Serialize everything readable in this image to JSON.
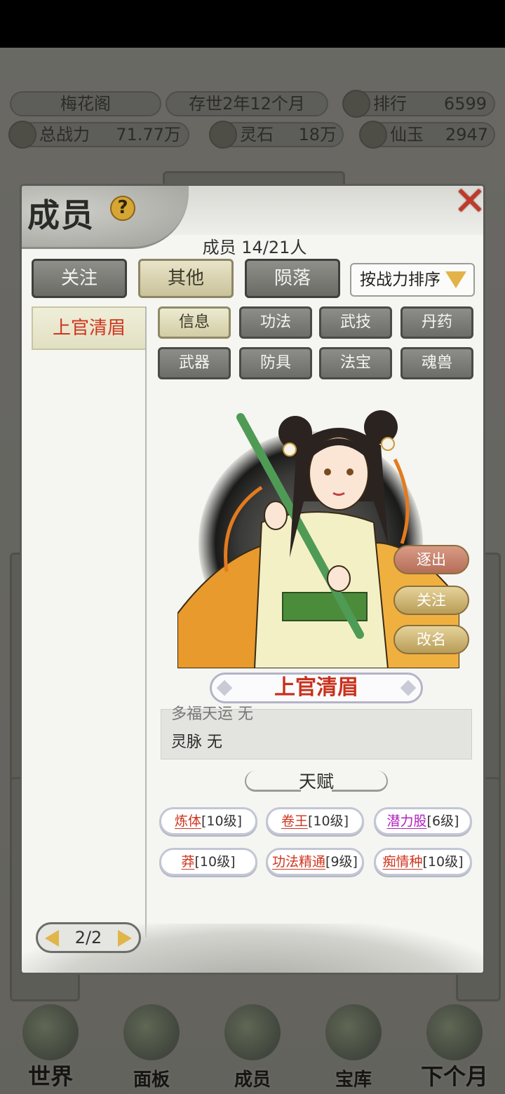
{
  "top_stats": {
    "sect_name": "梅花阁",
    "existence": "存世2年12个月",
    "rank_label": "排行",
    "rank_value": "6599",
    "power_label": "总战力",
    "power_value": "71.77万",
    "spirit_stone_label": "灵石",
    "spirit_stone_value": "18万",
    "immortal_jade_label": "仙玉",
    "immortal_jade_value": "2947"
  },
  "modal": {
    "title": "成员",
    "help_symbol": "?",
    "close_symbol": "✕",
    "member_count": "成员  14/21人",
    "filter_tabs": [
      {
        "label": "关注",
        "active": false
      },
      {
        "label": "其他",
        "active": true
      },
      {
        "label": "陨落",
        "active": false
      }
    ],
    "sort_label": "按战力排序",
    "members": [
      "上官清眉"
    ],
    "info_tabs": [
      {
        "label": "信息",
        "active": true
      },
      {
        "label": "功法",
        "active": false
      },
      {
        "label": "武技",
        "active": false
      },
      {
        "label": "丹药",
        "active": false
      },
      {
        "label": "武器",
        "active": false
      },
      {
        "label": "防具",
        "active": false
      },
      {
        "label": "法宝",
        "active": false
      },
      {
        "label": "魂兽",
        "active": false
      }
    ],
    "actions": {
      "expel": "逐出",
      "follow": "关注",
      "rename": "改名"
    },
    "character_name": "上官清眉",
    "attributes": {
      "partial_line": "多福天运 无",
      "spirit_vein": "灵脉 无"
    },
    "talent_title": "天赋",
    "talents": [
      {
        "name": "炼体",
        "level": "[10级]",
        "color": "red"
      },
      {
        "name": "卷王",
        "level": "[10级]",
        "color": "red"
      },
      {
        "name": "潜力股",
        "level": "[6级]",
        "color": "purple"
      },
      {
        "name": "莽",
        "level": "[10级]",
        "color": "red"
      },
      {
        "name": "功法精通",
        "level": "[9级]",
        "color": "red"
      },
      {
        "name": "痴情种",
        "level": "[10级]",
        "color": "red"
      }
    ],
    "pager": "2/2"
  },
  "bottom_nav": [
    {
      "label": "世界",
      "icon": "world-icon"
    },
    {
      "label": "面板",
      "icon": "panel-icon"
    },
    {
      "label": "成员",
      "icon": "members-icon"
    },
    {
      "label": "宝库",
      "icon": "treasury-icon"
    },
    {
      "label": "下个月",
      "icon": "next-month-icon"
    }
  ],
  "colors": {
    "accent_red": "#d0341f",
    "talent_purple": "#b21fbd",
    "gold": "#e0b64a"
  }
}
